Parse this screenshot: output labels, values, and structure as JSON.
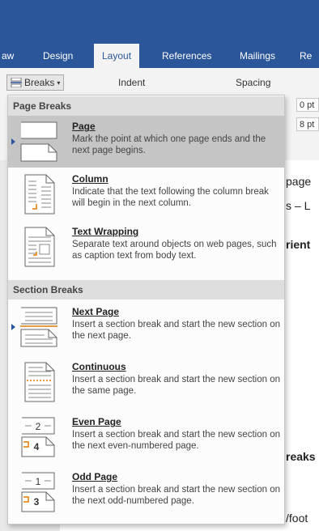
{
  "ribbon": {
    "tabs": [
      "aw",
      "Design",
      "Layout",
      "References",
      "Mailings",
      "Re"
    ],
    "active_tab": "Layout",
    "breaks_label": "Breaks",
    "indent_label": "Indent",
    "spacing_label": "Spacing",
    "spacing_before": "0 pt",
    "spacing_after": "8 pt"
  },
  "document": {
    "lines": [
      "page",
      "s – L",
      "rient",
      "reaks",
      "/foot"
    ]
  },
  "breaks_menu": {
    "page_breaks_header": "Page Breaks",
    "section_breaks_header": "Section Breaks",
    "items": [
      {
        "title": "Page",
        "desc": "Mark the point at which one page ends and the next page begins.",
        "icon": "page-break-icon",
        "selected": true
      },
      {
        "title": "Column",
        "desc": "Indicate that the text following the column break will begin in the next column.",
        "icon": "column-break-icon"
      },
      {
        "title": "Text Wrapping",
        "desc": "Separate text around objects on web pages, such as caption text from body text.",
        "icon": "text-wrapping-break-icon"
      },
      {
        "title": "Next Page",
        "desc": "Insert a section break and start the new section on the next page.",
        "icon": "next-page-break-icon"
      },
      {
        "title": "Continuous",
        "desc": "Insert a section break and start the new section on the same page.",
        "icon": "continuous-break-icon"
      },
      {
        "title": "Even Page",
        "desc": "Insert a section break and start the new section on the next even-numbered page.",
        "icon": "even-page-break-icon",
        "badge_top": "2",
        "badge_bottom": "4"
      },
      {
        "title": "Odd Page",
        "desc": "Insert a section break and start the new section on the next odd-numbered page.",
        "icon": "odd-page-break-icon",
        "badge_top": "1",
        "badge_bottom": "3"
      }
    ]
  },
  "colors": {
    "accent": "#2b579a",
    "selected": "#c5c5c5",
    "header": "#dedede"
  }
}
